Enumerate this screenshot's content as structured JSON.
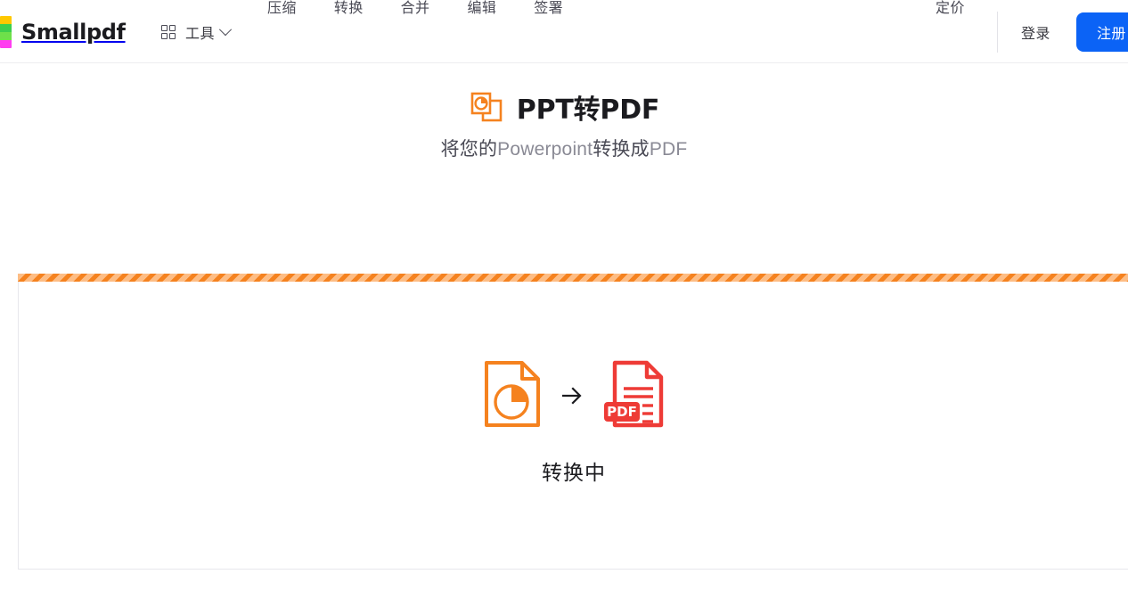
{
  "header": {
    "brand": {
      "name": "Smallpdf",
      "bar_colors": [
        "#ffc801",
        "#3ecf4c",
        "#6ee04a",
        "#ff3ef0"
      ]
    },
    "tools": {
      "label": "工具",
      "grid_icon": "grid-icon",
      "chevron_icon": "chevron-down-icon"
    },
    "nav_items": [
      {
        "label": "压缩"
      },
      {
        "label": "转换"
      },
      {
        "label": "合并"
      },
      {
        "label": "编辑"
      },
      {
        "label": "签署"
      }
    ],
    "pricing_label": "定价",
    "login_label": "登录",
    "signup_label": "注册",
    "signup_color": "#0b63f6"
  },
  "hero": {
    "icon": "powerpoint-file-icon",
    "title": "PPT转PDF",
    "subtitle_parts": [
      {
        "text": "将您的",
        "dim": false
      },
      {
        "text": "Powerpoint",
        "dim": true
      },
      {
        "text": "转换成",
        "dim": false
      },
      {
        "text": "PDF",
        "dim": true
      }
    ],
    "subtitle": "将您的Powerpoint转换成PDF"
  },
  "panel": {
    "progress": {
      "state": "in-progress",
      "stripe_dark": "#f5821f",
      "stripe_light": "#fdbd85"
    },
    "source_icon": "powerpoint-document-icon",
    "source_color": "#f5821f",
    "arrow_icon": "arrow-right-icon",
    "target_icon": "pdf-document-icon",
    "target_color": "#ee3b36",
    "target_badge_label": "PDF",
    "status_text": "转换中"
  }
}
